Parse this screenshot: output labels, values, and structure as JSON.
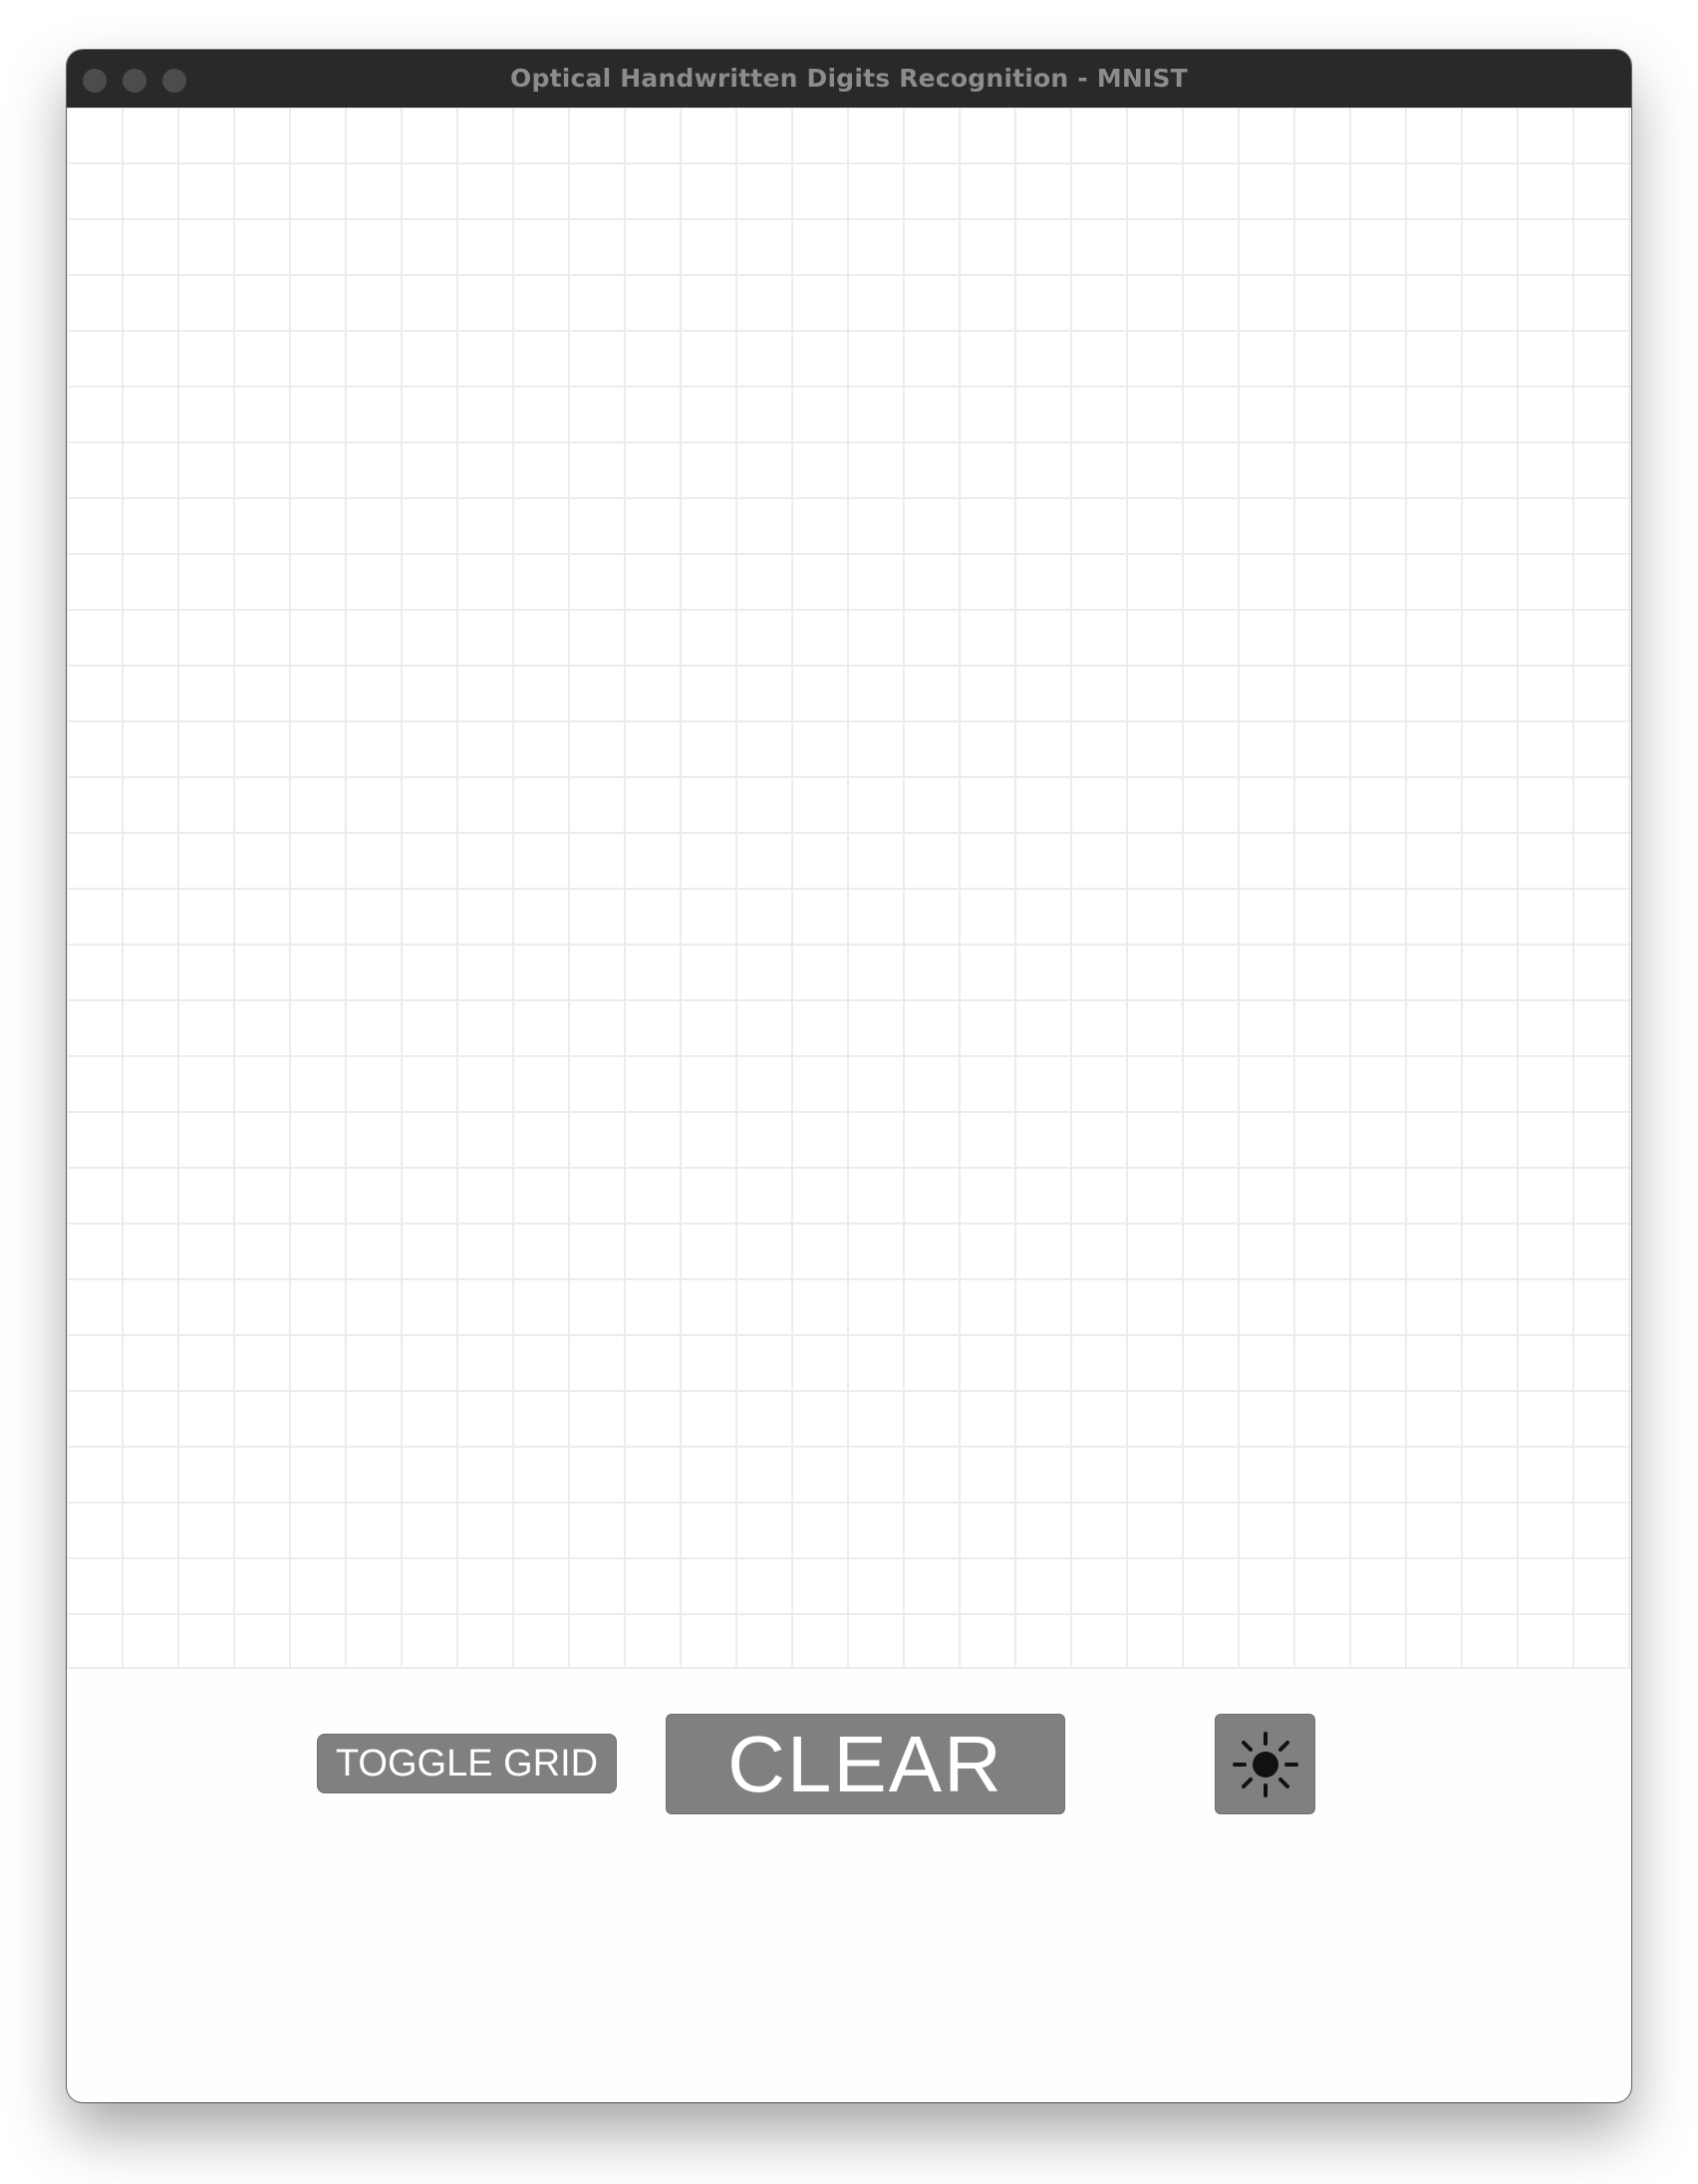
{
  "window": {
    "title": "Optical Handwritten Digits Recognition - MNIST",
    "titlebar_color": "#28292b",
    "traffic_light_color": "#4b4c4e"
  },
  "canvas": {
    "grid_visible": true,
    "grid_color": "#ececec",
    "background": "#ffffff"
  },
  "controls": {
    "toggle_grid_label": "TOGGLE GRID",
    "clear_label": "CLEAR",
    "theme_icon": "sun-icon",
    "button_color": "#808080",
    "button_text_color": "#ffffff"
  }
}
